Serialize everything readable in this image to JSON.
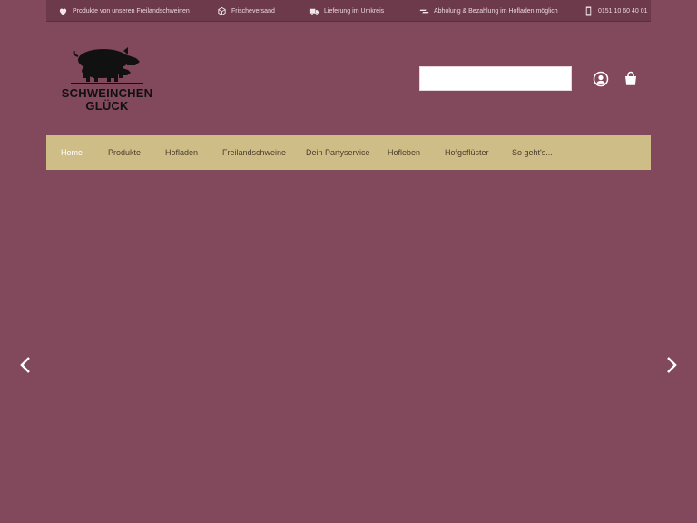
{
  "topbar": {
    "items": [
      {
        "icon": "heart-icon",
        "label": "Produkte von unseren Freilandschweinen"
      },
      {
        "icon": "box-icon",
        "label": "Frischeversand"
      },
      {
        "icon": "truck-icon",
        "label": "Lieferung im Umkreis"
      },
      {
        "icon": "money-icon",
        "label": "Abholung & Bezahlung im Hofladen möglich"
      },
      {
        "icon": "phone-icon",
        "label": "0151 10 60 40 01"
      }
    ]
  },
  "header": {
    "brand_line1": "SCHWEINCHEN",
    "brand_line2": "GLÜCK",
    "search_value": "",
    "search_placeholder": ""
  },
  "nav": {
    "items": [
      {
        "label": "Home",
        "active": true
      },
      {
        "label": "Produkte"
      },
      {
        "label": "Hofladen"
      },
      {
        "label": "Freilandschweine"
      },
      {
        "label": "Dein Partyservice"
      },
      {
        "label": "Hofleben"
      },
      {
        "label": "Hofgeflüster"
      },
      {
        "label": "So geht's..."
      }
    ]
  },
  "colors": {
    "background": "#82485c",
    "topbar": "#6d3a4c",
    "nav": "#cfbd88",
    "nav_text": "#4a3b2a",
    "nav_active": "#ffffff"
  }
}
